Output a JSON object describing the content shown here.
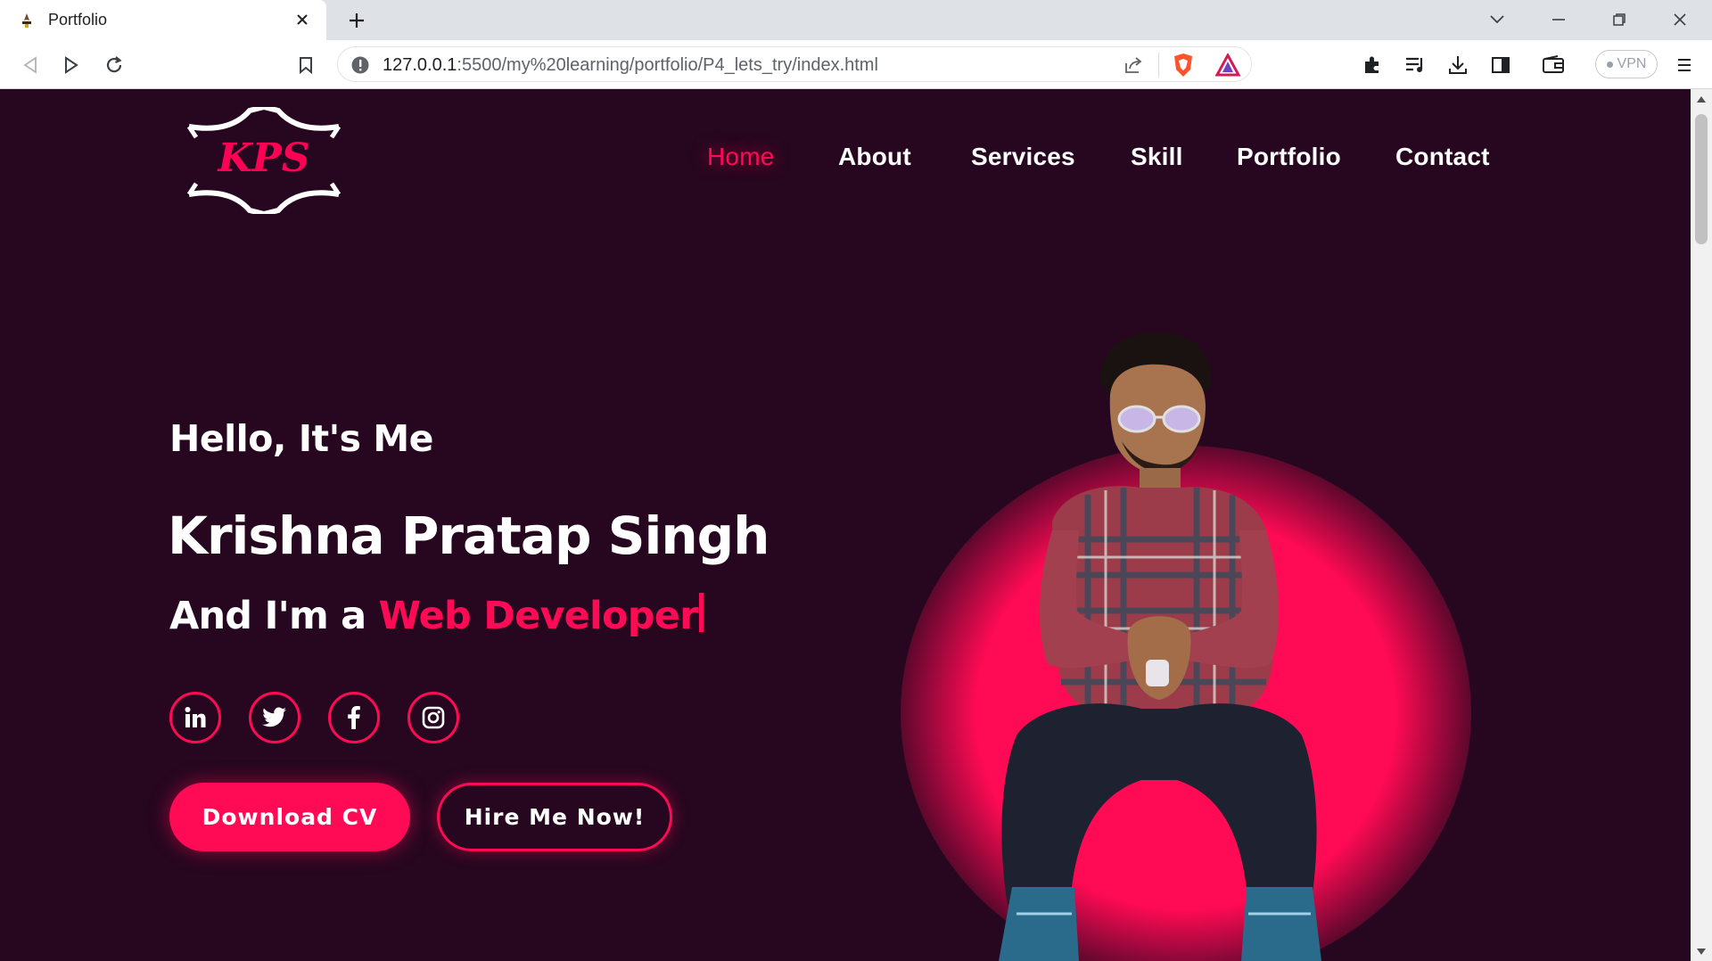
{
  "browser": {
    "tab_title": "Portfolio",
    "url_host": "127.0.0.1",
    "url_rest": ":5500/my%20learning/portfolio/P4_lets_try/index.html",
    "vpn_label": "VPN"
  },
  "site": {
    "logo_text": "KPS",
    "nav": [
      "Home",
      "About",
      "Services",
      "Skill",
      "Portfolio",
      "Contact"
    ],
    "active_nav": "Home",
    "hero": {
      "greeting": "Hello, It's Me",
      "name": "Krishna Pratap Singh",
      "role_prefix": "And I'm a ",
      "role_highlight": "Web Developer"
    },
    "social_icons": [
      "linkedin-icon",
      "twitter-icon",
      "facebook-icon",
      "instagram-icon"
    ],
    "buttons": {
      "download": "Download CV",
      "hire": "Hire Me Now!"
    }
  },
  "colors": {
    "background": "#26071f",
    "accent": "#ff0a54",
    "text": "#ffffff"
  }
}
